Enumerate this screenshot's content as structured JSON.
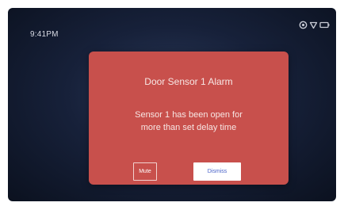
{
  "status_bar": {
    "time": "9:41PM",
    "icons": [
      "settings-icon",
      "shield-icon",
      "battery-icon"
    ]
  },
  "alarm": {
    "title": "Door Sensor 1 Alarm",
    "message_line1": "Sensor 1 has been open for",
    "message_line2": "more than set delay time",
    "mute_label": "Mute",
    "dismiss_label": "Dismiss"
  },
  "colors": {
    "dialog_background": "#c8504c",
    "screen_background": "#17213a",
    "dismiss_text": "#4a63c9"
  }
}
